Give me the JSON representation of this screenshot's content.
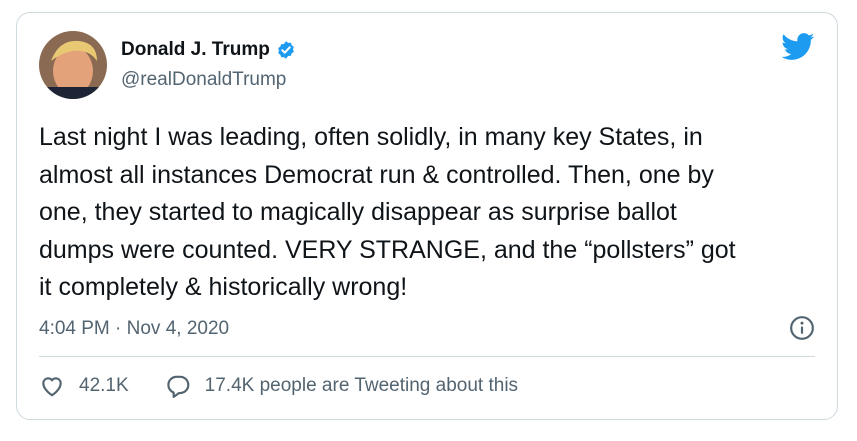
{
  "author": {
    "name": "Donald J. Trump",
    "handle": "@realDonaldTrump",
    "verified": true
  },
  "tweet": {
    "text": "Last night I was leading, often solidly, in many key States, in\nalmost all instances Democrat run & controlled. Then, one by\none, they started to magically disappear as surprise ballot\ndumps were counted. VERY STRANGE, and the “pollsters” got\nit completely & historically wrong!",
    "timestamp": "4:04 PM · Nov 4, 2020"
  },
  "actions": {
    "likes": "42.1K",
    "conversation": "17.4K people are Tweeting about this"
  },
  "icons": [
    "verified-badge-icon",
    "twitter-bird-icon",
    "info-icon",
    "heart-icon",
    "reply-icon"
  ],
  "colors": {
    "accent": "#1d9bf0",
    "secondary_text": "#536471",
    "border": "#cfd9de"
  }
}
